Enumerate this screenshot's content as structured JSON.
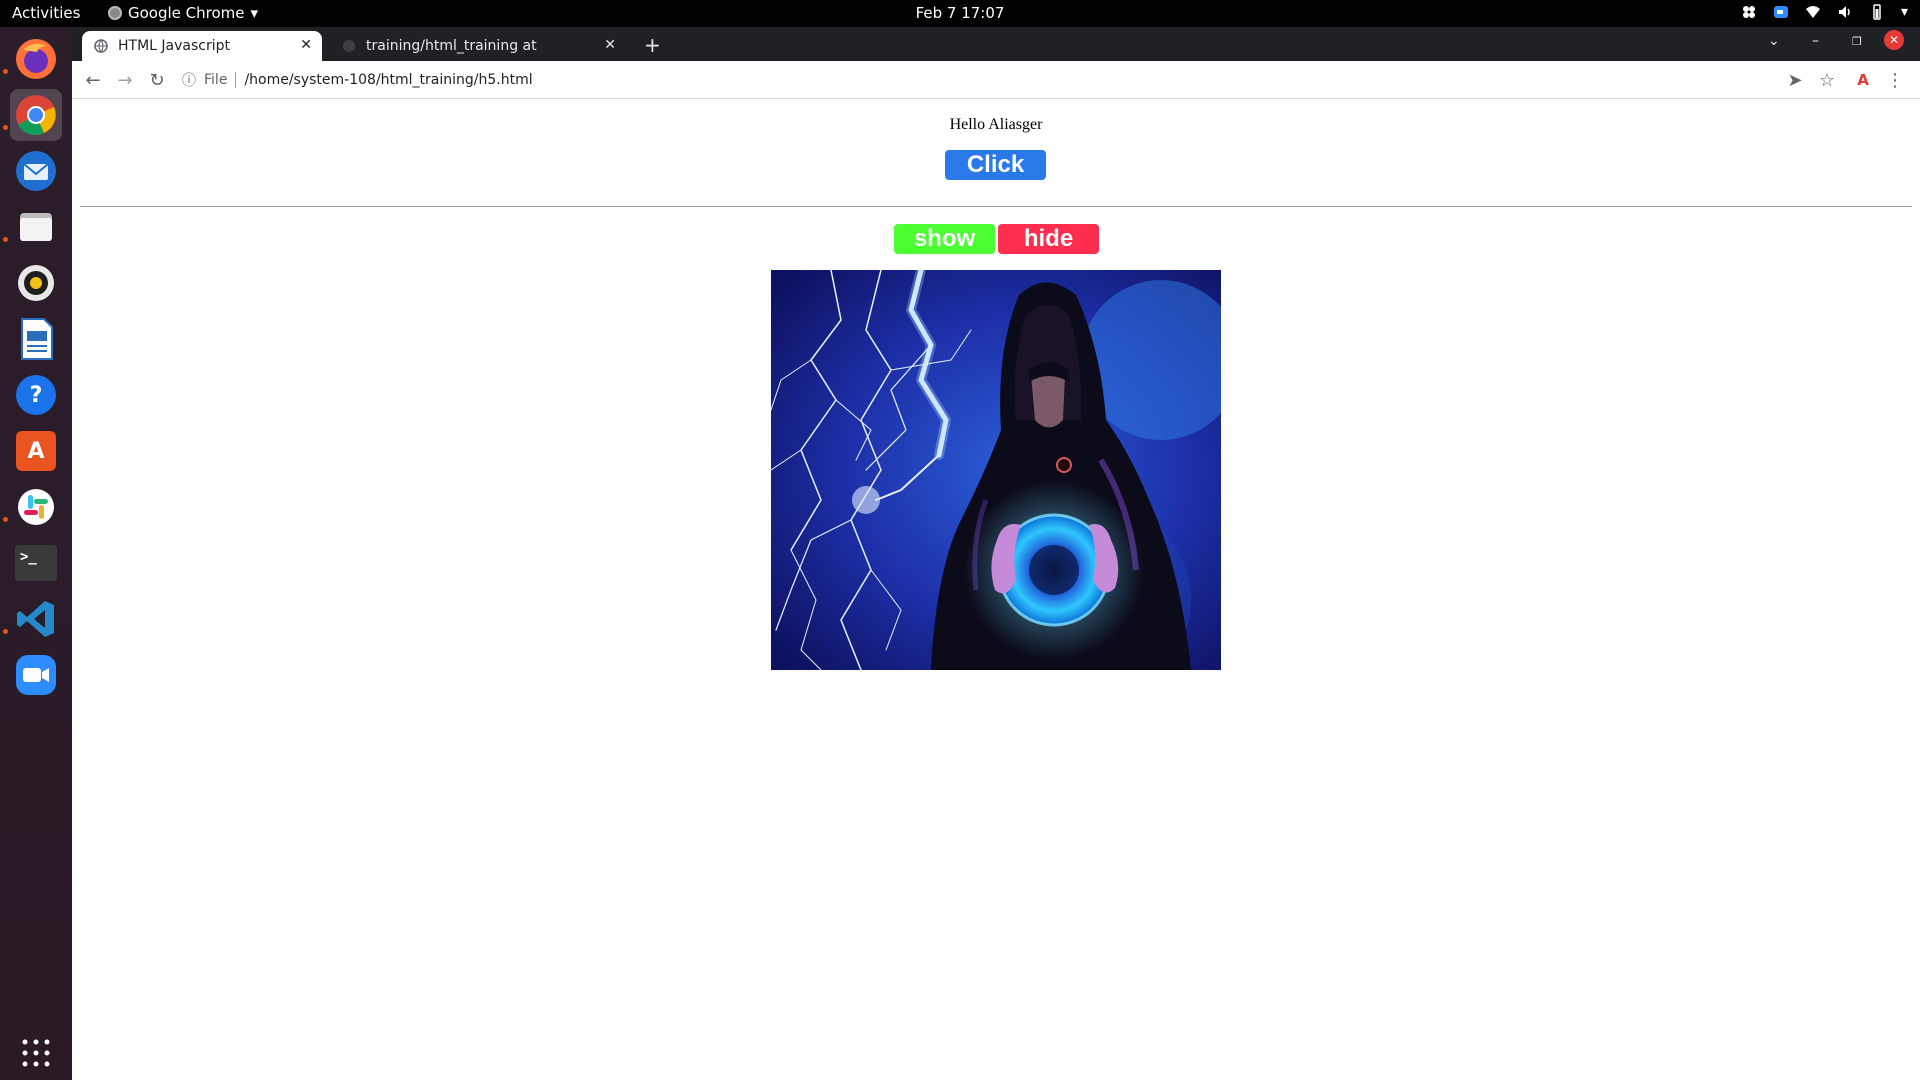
{
  "topbar": {
    "activities": "Activities",
    "app_name": "Google Chrome",
    "clock": "Feb 7  17:07"
  },
  "dock": {
    "items": [
      {
        "name": "firefox-icon"
      },
      {
        "name": "chrome-icon"
      },
      {
        "name": "thunderbird-icon"
      },
      {
        "name": "files-icon"
      },
      {
        "name": "rhythmbox-icon"
      },
      {
        "name": "libreoffice-writer-icon"
      },
      {
        "name": "help-icon",
        "glyph": "?"
      },
      {
        "name": "software-center-icon",
        "glyph": "A"
      },
      {
        "name": "slack-icon"
      },
      {
        "name": "terminal-icon",
        "glyph": ">_"
      },
      {
        "name": "vscode-icon"
      },
      {
        "name": "zoom-icon"
      }
    ]
  },
  "browser": {
    "tabs": [
      {
        "label": "HTML Javascript",
        "close": "✕"
      },
      {
        "label": "training/html_training at",
        "close": "✕"
      }
    ],
    "new_tab": "+",
    "omnibox": {
      "scheme": "File",
      "url": "/home/system-108/html_training/h5.html"
    }
  },
  "page": {
    "greeting": "Hello Aliasger",
    "click_button": "Click",
    "show_button": "show",
    "hide_button": "hide"
  },
  "colors": {
    "click_button": "#2979e8",
    "show_button": "#4cff32",
    "hide_button": "#ff2d4e"
  }
}
